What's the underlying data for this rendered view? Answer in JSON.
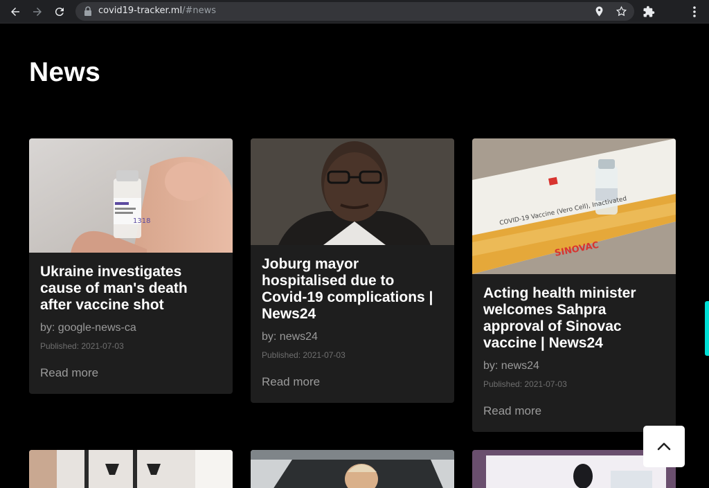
{
  "browser": {
    "url_host": "covid19-tracker.ml",
    "url_path": "/#news",
    "icons": [
      "back-icon",
      "forward-icon",
      "reload-icon",
      "lock-icon",
      "location-icon",
      "star-icon",
      "extensions-icon",
      "menu-icon"
    ]
  },
  "page": {
    "title": "News",
    "accent_color": "#00e0d6"
  },
  "news": [
    {
      "title": "Ukraine investigates cause of man's death after vaccine shot",
      "source": "by: google-news-ca",
      "date": "Published: 2021-07-03",
      "link": "Read more"
    },
    {
      "title": "Joburg mayor hospitalised due to Covid-19 complications | News24",
      "source": "by: news24",
      "date": "Published: 2021-07-03",
      "link": "Read more"
    },
    {
      "title": "Acting health minister welcomes Sahpra approval of Sinovac vaccine | News24",
      "source": "by: news24",
      "date": "Published: 2021-07-03",
      "link": "Read more"
    }
  ],
  "scroll_top": {
    "icon": "chevron-up-icon"
  }
}
